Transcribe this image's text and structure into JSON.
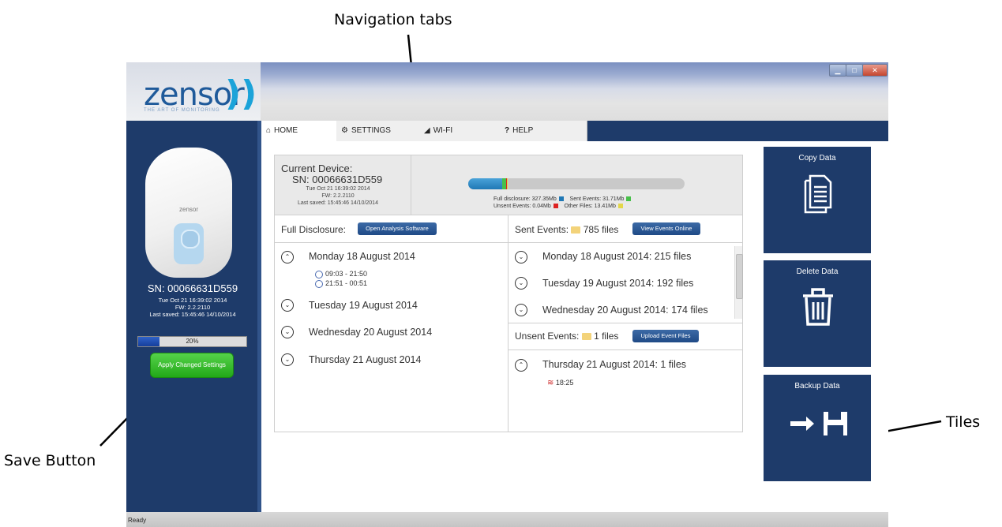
{
  "annotations": {
    "nav_tabs": "Navigation tabs",
    "save_button": "Save Button",
    "tiles": "Tiles"
  },
  "logo": {
    "name": "zensor",
    "tagline": "THE ART OF MONITORING"
  },
  "sidebar": {
    "device_brand": "zensor",
    "serial": "SN: 00066631D559",
    "date": "Tue Oct 21 16:39:02 2014",
    "firmware": "FW: 2.2.2110",
    "last_saved": "Last saved: 15:45:46 14/10/2014",
    "progress_percent": 20,
    "progress_label": "20%",
    "apply_button": "Apply Changed Settings"
  },
  "tabs": [
    {
      "label": "HOME",
      "icon": "home-icon",
      "active": true
    },
    {
      "label": "SETTINGS",
      "icon": "gear-icon",
      "active": false
    },
    {
      "label": "WI-FI",
      "icon": "wifi-icon",
      "active": false
    },
    {
      "label": "HELP",
      "icon": "help-icon",
      "active": false
    }
  ],
  "main": {
    "current_device_label": "Current Device:",
    "serial": "SN: 00066631D559",
    "date": "Tue Oct 21 16:39:02 2014",
    "firmware": "FW: 2.2.2110",
    "last_saved": "Last saved: 15:45:46 14/10/2014",
    "storage": {
      "full_disclosure": "Full disclosure: 327.35Mb",
      "sent_events": "Sent Events: 31.71Mb",
      "unsent_events": "Unsent Events: 0.04Mb",
      "other_files": "Other Files: 13.41Mb",
      "full_mb": 327.35,
      "sent_mb": 31.71,
      "unsent_mb": 0.04,
      "other_mb": 13.41,
      "colors": {
        "full": "#1f78b5",
        "sent": "#48c04a",
        "unsent": "#dd2222",
        "other": "#e3d74a"
      }
    },
    "full_disclosure": {
      "label": "Full Disclosure:",
      "button": "Open Analysis Software",
      "days": [
        {
          "label": "Monday 18 August 2014",
          "expanded": true,
          "ranges": [
            "09:03 - 21:50",
            "21:51 - 00:51"
          ]
        },
        {
          "label": "Tuesday 19 August 2014",
          "expanded": false
        },
        {
          "label": "Wednesday 20 August 2014",
          "expanded": false
        },
        {
          "label": "Thursday 21 August 2014",
          "expanded": false
        }
      ]
    },
    "sent_events": {
      "label": "Sent Events:",
      "count": "785 files",
      "button": "View Events Online",
      "days": [
        "Monday 18 August 2014:  215 files",
        "Tuesday 19 August 2014:  192 files",
        "Wednesday 20 August 2014:  174 files"
      ]
    },
    "unsent_events": {
      "label": "Unsent Events:",
      "count": "1 files",
      "button": "Upload Event Files",
      "days": [
        {
          "label": "Thursday 21 August 2014:  1 files",
          "time": "18:25"
        }
      ]
    }
  },
  "tiles": [
    {
      "label": "Copy Data",
      "icon": "copy-document-icon"
    },
    {
      "label": "Delete Data",
      "icon": "trash-icon"
    },
    {
      "label": "Backup Data",
      "icon": "save-disk-icon"
    }
  ],
  "status": "Ready"
}
